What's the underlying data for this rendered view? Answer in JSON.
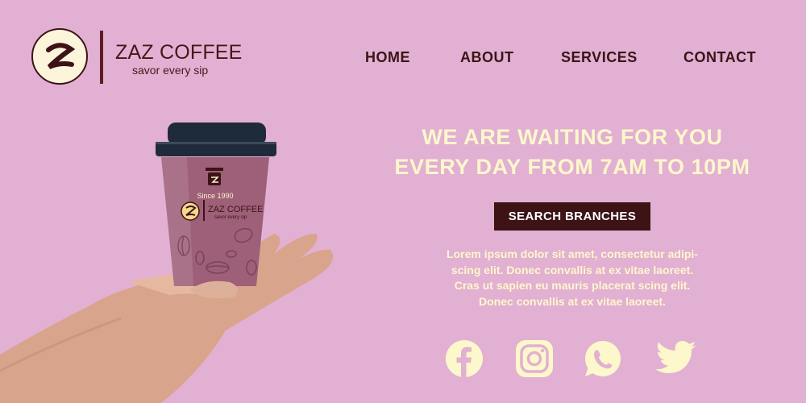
{
  "brand": {
    "name": "ZAZ COFFEE",
    "tagline": "savor every sip",
    "logo_letter": "Z"
  },
  "nav": {
    "items": [
      {
        "label": "HOME"
      },
      {
        "label": "ABOUT"
      },
      {
        "label": "SERVICES"
      },
      {
        "label": "CONTACT"
      }
    ]
  },
  "hero": {
    "headline_line1": "WE ARE WAITING FOR YOU",
    "headline_line2": "EVERY DAY FROM 7AM TO 10PM",
    "cta_label": "SEARCH BRANCHES",
    "description_lines": [
      "Lorem ipsum dolor sit amet, consectetur adipi-",
      "scing elit. Donec convallis at ex vitae laoreet.",
      "Cras ut sapien eu mauris placerat scing elit.",
      "Donec convallis at ex vitae laoreet."
    ]
  },
  "product": {
    "cup_since": "Since 1990",
    "cup_brand": "ZAZ COFFEE",
    "cup_tagline": "savor every sip"
  },
  "social": [
    "facebook-icon",
    "instagram-icon",
    "whatsapp-icon",
    "twitter-icon"
  ],
  "colors": {
    "background": "#e2b0d2",
    "accent_dark": "#3d1316",
    "text_light": "#fdf7cc",
    "cup_body": "#9e5f78",
    "cup_lid": "#1f2a3a"
  }
}
